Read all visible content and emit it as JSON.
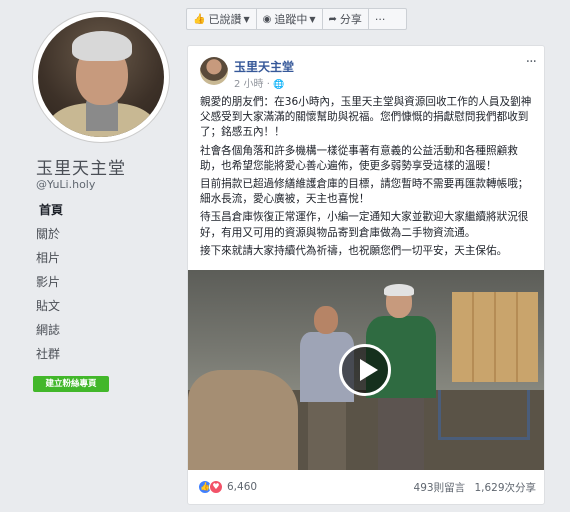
{
  "page": {
    "name": "玉里天主堂",
    "handle": "@YuLi.holy"
  },
  "nav": {
    "items": [
      {
        "label": "首頁",
        "active": true
      },
      {
        "label": "關於",
        "active": false
      },
      {
        "label": "相片",
        "active": false
      },
      {
        "label": "影片",
        "active": false
      },
      {
        "label": "貼文",
        "active": false
      },
      {
        "label": "網誌",
        "active": false
      },
      {
        "label": "社群",
        "active": false
      }
    ],
    "create_button": "建立粉絲專頁"
  },
  "action_bar": {
    "liked": "已說讚",
    "following": "追蹤中",
    "share": "分享",
    "more": "···"
  },
  "post": {
    "author": "玉里天主堂",
    "time": "2 小時",
    "globe_icon": "globe-icon",
    "more": "···",
    "paragraphs": [
      "親愛的朋友們：在36小時內，玉里天主堂與資源回收工作的人員及劉神父感受到大家滿滿的關懷幫助與祝福。您們慷慨的捐獻慰問我們都收到了；銘感五內！！",
      "社會各個角落和許多機構一樣從事著有意義的公益活動和各種照顧救助，也希望您能將愛心善心遍佈，使更多弱勢享受這樣的溫暖！",
      "目前捐款已超過修繕維護倉庫的目標，請您暫時不需要再匯款轉帳哦；細水長流，愛心廣被，天主也喜悅！",
      "待玉昌倉庫恢復正常運作，小編一定通知大家並歡迎大家繼續將狀況很好，有用又可用的資源與物品寄到倉庫做為二手物資流通。",
      "接下來就請大家持續代為祈禱，也祝願您們一切平安，天主保佑。"
    ],
    "reactions_count": "6,460",
    "comments": "493則留言",
    "shares": "1,629次分享",
    "colors": {
      "link": "#365899",
      "like": "#4080ff",
      "love": "#f25268",
      "create_button": "#42b72a"
    }
  }
}
